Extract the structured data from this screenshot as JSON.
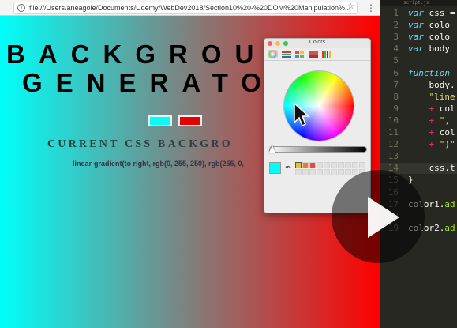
{
  "browser": {
    "url": "file:///Users/aneagoie/Documents/Udemy/WebDev2018/Section10%20-%20DOM%20Manipulation%...",
    "back_icon": "arrow-left-icon",
    "forward_icon": "arrow-right-icon",
    "reload_icon": "reload-icon",
    "info_icon": "info-icon",
    "info_glyph": "i",
    "bookmark_icon": "star-icon",
    "menu_icon": "kebab-menu-icon"
  },
  "page": {
    "headline_line1": "BACKGROU",
    "headline_line2": "GENERATO",
    "color1_value": "#00fffa",
    "color2_value": "#e60000",
    "current_title": "CURRENT CSS BACKGRO",
    "css_text": "linear-gradient(to right, rgb(0, 255, 250), rgb(255, 0,",
    "gradient_from": "#00fffa",
    "gradient_to": "#ff0000"
  },
  "colors_panel": {
    "title": "Colors",
    "modes": [
      "color-wheel-icon",
      "sliders-icon",
      "palettes-icon",
      "image-palettes-icon",
      "crayons-icon"
    ],
    "active_mode": "color-wheel-icon",
    "current_color": "#00fffa",
    "eyedropper_icon": "eyedropper-icon",
    "saved_swatches": [
      "#f1c40f",
      "#e67e22",
      "#e74c3c"
    ]
  },
  "editor": {
    "tab_label": "script.js",
    "lines": [
      {
        "n": "1",
        "html": "<span class='kw'>var</span> <span class='plain'>css =</span>"
      },
      {
        "n": "2",
        "html": "<span class='kw'>var</span> <span class='plain'>colo</span>"
      },
      {
        "n": "3",
        "html": "<span class='kw'>var</span> <span class='plain'>colo</span>"
      },
      {
        "n": "4",
        "html": "<span class='kw'>var</span> <span class='plain'>body</span>"
      },
      {
        "n": "5",
        "html": ""
      },
      {
        "n": "6",
        "html": "<span class='kw'>function</span>"
      },
      {
        "n": "7",
        "html": "<span class='plain'>    body.</span>"
      },
      {
        "n": "8",
        "html": "<span class='str'>    \"line</span>"
      },
      {
        "n": "9",
        "html": "<span class='plus'>    +</span> <span class='plain'>col</span>"
      },
      {
        "n": "10",
        "html": "<span class='plus'>    +</span> <span class='str'>\", </span>"
      },
      {
        "n": "11",
        "html": "<span class='plus'>    +</span> <span class='plain'>col</span>"
      },
      {
        "n": "12",
        "html": "<span class='plus'>    +</span> <span class='str'>\")\"</span>"
      },
      {
        "n": "13",
        "html": ""
      },
      {
        "n": "14",
        "html": "<span class='plain'>    css.t</span>"
      },
      {
        "n": "15",
        "html": "<span class='plain'>}</span>"
      },
      {
        "n": "16",
        "html": ""
      },
      {
        "n": "17",
        "html": "<span class='plain'>color1.</span><span class='fn'>ad</span>"
      },
      {
        "n": "18",
        "html": ""
      },
      {
        "n": "19",
        "html": "<span class='plain'>color2.</span><span class='fn'>ad</span>"
      }
    ],
    "highlight_line": "14"
  },
  "video": {
    "play_icon": "play-icon"
  }
}
